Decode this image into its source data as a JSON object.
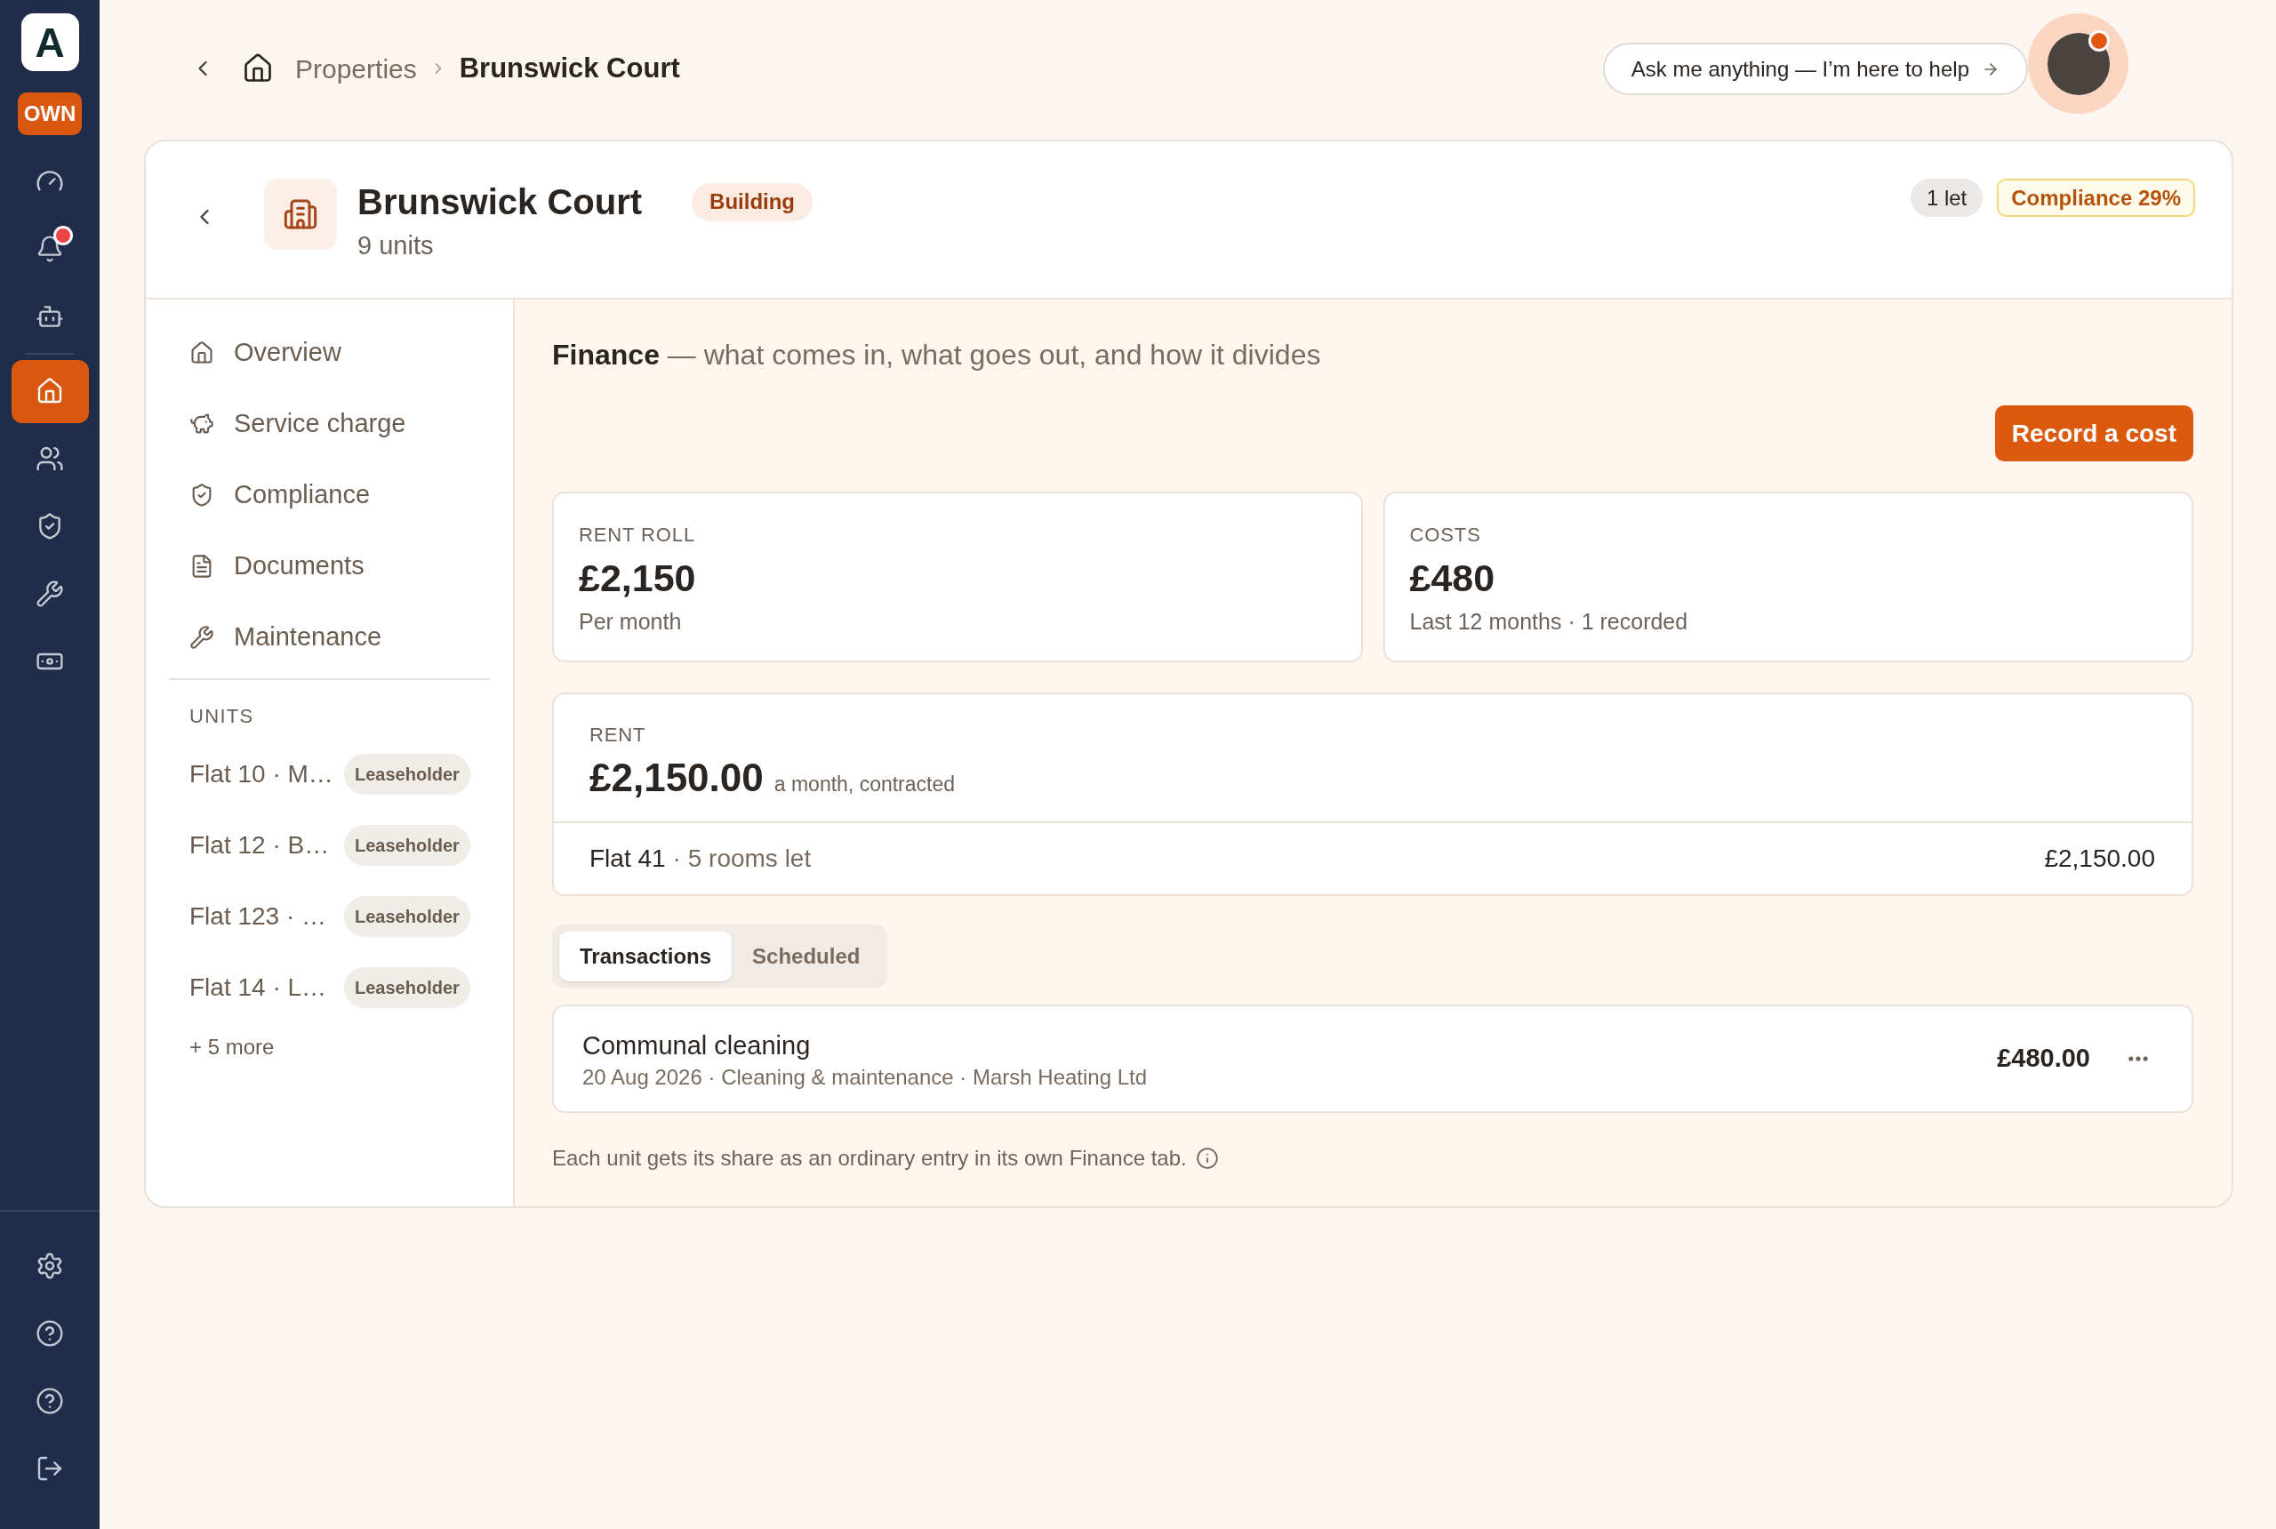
{
  "rail": {
    "logo": "A",
    "badge": "OWN",
    "groups": [
      {
        "items": [
          {
            "selected": false,
            "alert": false
          },
          {
            "selected": false,
            "alert": true
          },
          {
            "selected": false,
            "alert": false
          }
        ]
      },
      {
        "items": [
          {
            "selected": true,
            "alert": false
          },
          {
            "selected": false,
            "alert": false
          },
          {
            "selected": false,
            "alert": false
          },
          {
            "selected": false,
            "alert": false
          },
          {
            "selected": false,
            "alert": false
          }
        ]
      }
    ],
    "footer_items": [
      {
        "selected": false
      },
      {
        "selected": false
      },
      {
        "selected": false
      },
      {
        "selected": false
      }
    ]
  },
  "breadcrumb": {
    "items": [
      {
        "label": "Properties",
        "current": false
      },
      {
        "label": "Brunswick Court",
        "current": true
      }
    ]
  },
  "assistant": {
    "prompt": "Ask me anything — I’m here to help"
  },
  "avatar": {
    "alert": true
  },
  "property": {
    "title": "Brunswick Court",
    "type": "Building",
    "subtitle": "9 units",
    "badges": [
      {
        "label": "1 let",
        "kind": "neutral"
      },
      {
        "label": "Compliance 29%",
        "kind": "warning"
      }
    ]
  },
  "sidebar": {
    "items": [
      {
        "label": "Overview",
        "selected": false
      },
      {
        "label": "Service charge",
        "selected": false
      },
      {
        "label": "Compliance",
        "selected": false
      },
      {
        "label": "Documents",
        "selected": false
      },
      {
        "label": "Maintenance",
        "selected": false
      }
    ],
    "units_heading": "UNITS",
    "units": [
      {
        "name": "Flat 10 · M…",
        "tag": "Leaseholder"
      },
      {
        "name": "Flat 12 · B…",
        "tag": "Leaseholder"
      },
      {
        "name": "Flat 123 · …",
        "tag": "Leaseholder"
      },
      {
        "name": "Flat 14 · L…",
        "tag": "Leaseholder"
      }
    ],
    "more": "+ 5 more"
  },
  "finance": {
    "heading": "**Finance** — what comes in, what goes out, and how it divides",
    "record_button": "Record a cost",
    "stats": [
      {
        "label": "RENT ROLL",
        "value": "£2,150",
        "caption": "Per month"
      },
      {
        "label": "COSTS",
        "value": "£480",
        "caption": "Last 12 months · 1 recorded"
      }
    ],
    "rent": {
      "label": "RENT",
      "amount": "£2,150.00",
      "period": "a month, contracted",
      "rows": [
        {
          "unit": "Flat 41",
          "detail": "· 5 rooms let",
          "amount": "£2,150.00"
        }
      ]
    },
    "tabs": [
      {
        "label": "Transactions",
        "selected": true
      },
      {
        "label": "Scheduled",
        "selected": false
      }
    ],
    "transactions": [
      {
        "title": "Communal cleaning",
        "meta": "20 Aug 2026 · Cleaning & maintenance · Marsh Heating Ltd",
        "amount": "£480.00"
      }
    ],
    "note": "Each unit gets its share as an ordinary entry in its own Finance tab."
  }
}
